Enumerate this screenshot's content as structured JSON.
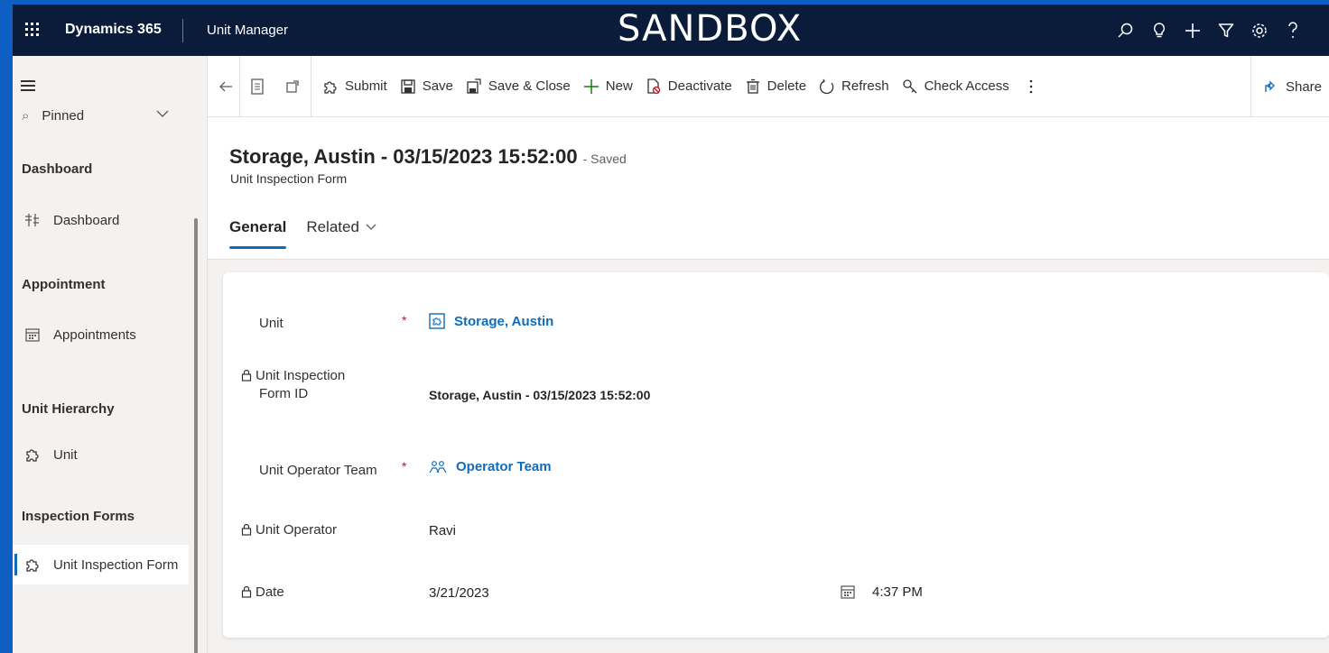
{
  "topbar": {
    "brand": "Dynamics 365",
    "app_name": "Unit Manager",
    "environment": "SANDBOX",
    "icons": [
      "search-icon",
      "lightbulb-icon",
      "plus-icon",
      "filter-icon",
      "settings-icon",
      "help-icon"
    ]
  },
  "sidebar": {
    "pinned_label": "Pinned",
    "groups": [
      {
        "title": "Dashboard",
        "items": [
          {
            "label": "Dashboard",
            "icon": "dashboard-icon"
          }
        ]
      },
      {
        "title": "Appointment",
        "items": [
          {
            "label": "Appointments",
            "icon": "calendar-icon"
          }
        ]
      },
      {
        "title": "Unit Hierarchy",
        "items": [
          {
            "label": "Unit",
            "icon": "puzzle-icon"
          }
        ]
      },
      {
        "title": "Inspection Forms",
        "items": [
          {
            "label": "Unit Inspection Form",
            "icon": "puzzle-icon",
            "active": true
          }
        ]
      }
    ]
  },
  "commandbar": {
    "submit": "Submit",
    "save": "Save",
    "save_close": "Save & Close",
    "new": "New",
    "deactivate": "Deactivate",
    "delete": "Delete",
    "refresh": "Refresh",
    "check_access": "Check Access",
    "share": "Share"
  },
  "record": {
    "title": "Storage, Austin - 03/15/2023 15:52:00",
    "status": "- Saved",
    "form_name": "Unit Inspection Form"
  },
  "tabs": [
    {
      "label": "General",
      "active": true
    },
    {
      "label": "Related",
      "active": false
    }
  ],
  "form": {
    "unit_label": "Unit",
    "unit_value": "Storage, Austin",
    "form_id_label_1": "Unit Inspection",
    "form_id_label_2": "Form ID",
    "form_id_value": "Storage, Austin - 03/15/2023 15:52:00",
    "team_label": "Unit Operator Team",
    "team_value": "Operator Team",
    "operator_label": "Unit Operator",
    "operator_value": "Ravi",
    "date_label": "Date",
    "date_value": "3/21/2023",
    "time_value": "4:37 PM",
    "required_marker": "*"
  },
  "colors": {
    "outer_border": "#0d5fc4",
    "topbar_bg": "#0b1c3b",
    "accent": "#0f6cbd",
    "required": "#a4262c"
  }
}
